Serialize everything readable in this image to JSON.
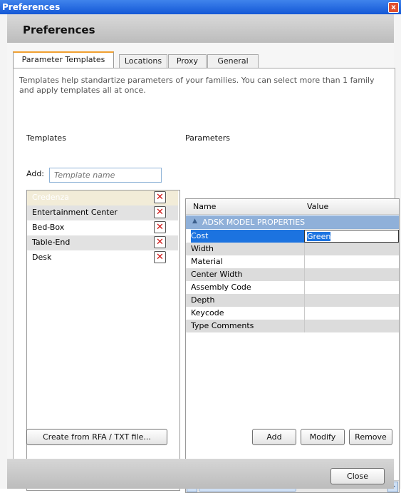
{
  "window": {
    "title": "Preferences",
    "close_glyph": "x"
  },
  "header": {
    "title": "Preferences"
  },
  "tabs": [
    {
      "label": "Parameter Templates",
      "active": true
    },
    {
      "label": "Locations",
      "active": false
    },
    {
      "label": "Proxy",
      "active": false
    },
    {
      "label": "General",
      "active": false
    }
  ],
  "description": "Templates help standartize parameters of your families. You can select more than 1 family and apply templates all at once.",
  "templates": {
    "heading": "Templates",
    "add_label": "Add:",
    "add_placeholder": "Template name",
    "items": [
      "Credenza",
      "Entertainment Center",
      "Bed-Box",
      "Table-End",
      "Desk"
    ],
    "selected_index": 0,
    "delete_glyph": "✕",
    "create_button": "Create from RFA / TXT file..."
  },
  "parameters": {
    "heading": "Parameters",
    "columns": [
      "Name",
      "Value"
    ],
    "group": "ADSK MODEL PROPERTIES",
    "rows": [
      {
        "name": "Cost",
        "value": "Green"
      },
      {
        "name": "Width",
        "value": ""
      },
      {
        "name": "Material",
        "value": ""
      },
      {
        "name": "Center Width",
        "value": ""
      },
      {
        "name": "Assembly Code",
        "value": ""
      },
      {
        "name": "Depth",
        "value": ""
      },
      {
        "name": "Keycode",
        "value": ""
      },
      {
        "name": "Type Comments",
        "value": ""
      }
    ],
    "add_button": "Add",
    "modify_button": "Modify",
    "remove_button": "Remove"
  },
  "footer": {
    "close_button": "Close"
  },
  "colors": {
    "titlebar": "#1f63dd",
    "group_header": "#8fb0d9",
    "selection": "#1c73e0",
    "delete_red": "#d01010",
    "active_tab_accent": "#f0a030"
  }
}
